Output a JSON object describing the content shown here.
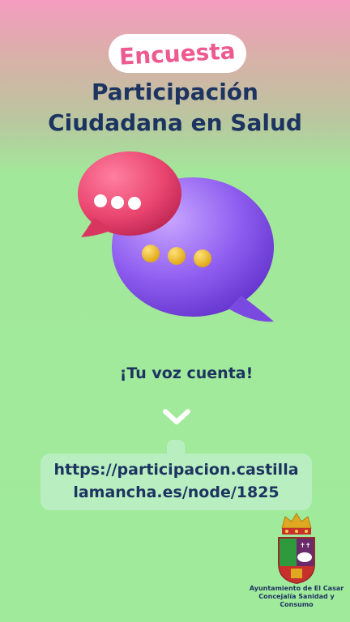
{
  "badge": {
    "label": "Encuesta"
  },
  "title": {
    "line1": "Participación",
    "line2": "Ciudadana en Salud"
  },
  "tagline": {
    "text": "¡Tu voz cuenta!"
  },
  "link": {
    "line1": "https://participacion.castilla",
    "line2": "lamancha.es/node/1825"
  },
  "footer": {
    "line1": "Ayuntamiento de El Casar",
    "line2": "Concejalía Sanidad y",
    "line3": "Consumo"
  },
  "colors": {
    "title": "#1d3461",
    "badge_text": "#ec5a90",
    "bubble_pink": "#e9456f",
    "bubble_purple": "#8f5ef0",
    "dots_yellow": "#f2c230",
    "background_green": "#a0ea9c",
    "background_pink": "#f59cc0"
  },
  "icons": {
    "illustration": "chat-bubbles-icon",
    "arrow": "chevron-down-icon",
    "logo": "coat-of-arms-logo"
  }
}
